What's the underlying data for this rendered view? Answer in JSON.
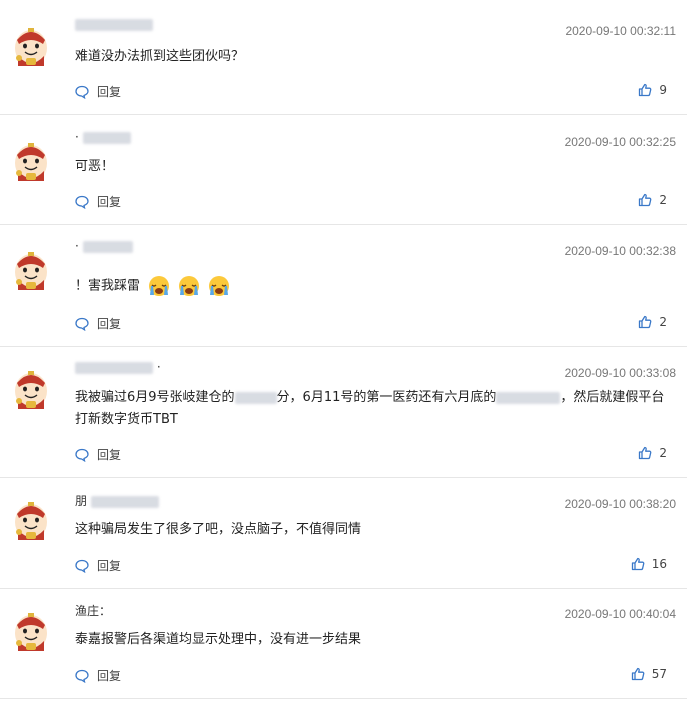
{
  "reply_label": "回复",
  "colors": {
    "like_icon": "#3a78c8",
    "reply_icon": "#3a78c8",
    "divider": "#e6e6e6"
  },
  "comments": [
    {
      "username": "",
      "time": "2020-09-10 00:32:11",
      "content": "难道没办法抓到这些团伙吗？",
      "likes": "9"
    },
    {
      "username": "·",
      "time": "2020-09-10 00:32:25",
      "content": "可恶！",
      "likes": "2"
    },
    {
      "username": "·",
      "time": "2020-09-10 00:32:38",
      "content": "！害我踩雷",
      "likes": "2"
    },
    {
      "username": "·",
      "time": "2020-09-10 00:33:08",
      "content_part1": "我被骗过6月9号张岐建仓的",
      "content_part2": "分，6月11号的第一医药还有六月底的",
      "content_part3": "，然后就建假平台打新数字货币TBT",
      "likes": "2"
    },
    {
      "username": "朋",
      "time": "2020-09-10 00:38:20",
      "content": "这种骗局发生了很多了吧，没点脑子，不值得同情",
      "likes": "16"
    },
    {
      "username": "渔庄：",
      "time": "2020-09-10 00:40:04",
      "content": "泰嘉报警后各渠道均显示处理中，没有进一步结果",
      "likes": "57"
    }
  ]
}
